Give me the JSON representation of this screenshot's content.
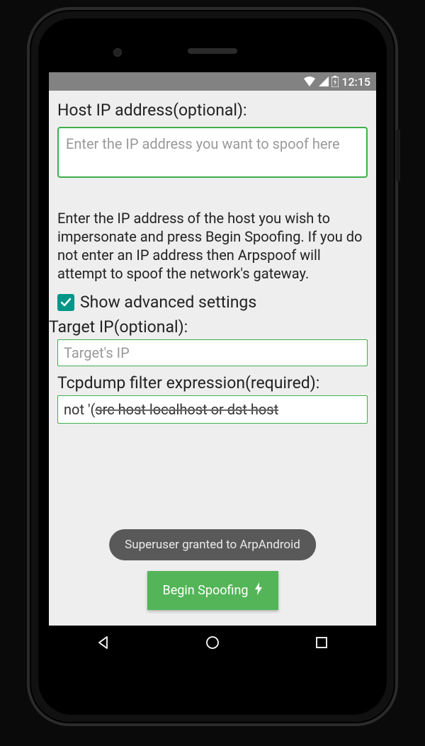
{
  "statusbar": {
    "time": "12:15"
  },
  "host": {
    "label": "Host IP address(optional):",
    "placeholder": "Enter the IP address you want to spoof here"
  },
  "description": "Enter the IP address of the host you wish to impersonate and press Begin Spoofing. If you do not enter an IP address then Arpspoof will attempt to spoof the network's gateway.",
  "advanced": {
    "checkbox_label": "Show advanced settings",
    "checked": true
  },
  "target": {
    "label": "Target IP(optional):",
    "placeholder": "Target's IP"
  },
  "filter": {
    "label": "Tcpdump filter expression(required):",
    "value_prefix": "not '(",
    "value_struck": "src host localhost or dst host"
  },
  "toast": "Superuser granted to ArpAndroid",
  "button": {
    "label": "Begin Spoofing"
  },
  "colors": {
    "accent": "#3fae4a",
    "teal": "#009688",
    "button": "#53b558",
    "statusbar": "#828282"
  }
}
